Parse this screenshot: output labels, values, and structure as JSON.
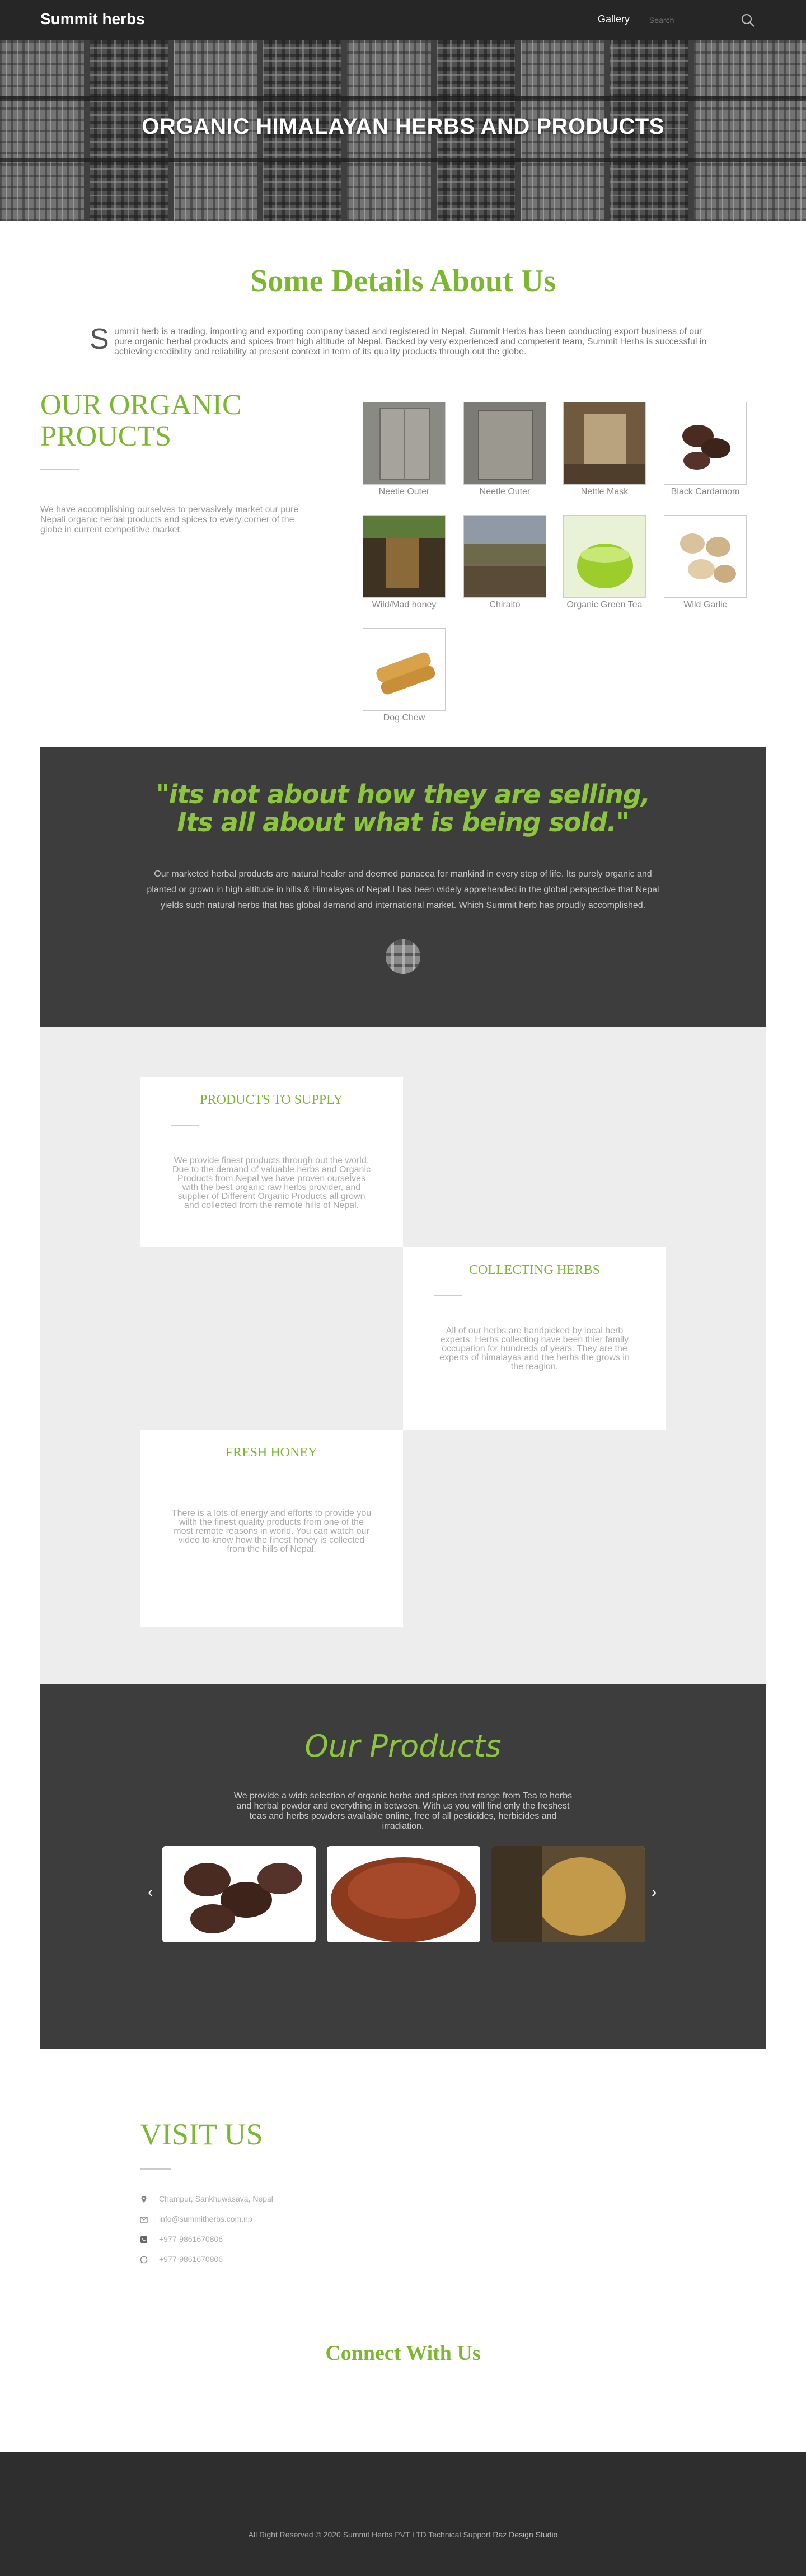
{
  "header": {
    "brand": "Summit herbs",
    "nav_gallery": "Gallery",
    "search_placeholder": "Search"
  },
  "hero": {
    "title": "ORGANIC HIMALAYAN HERBS AND PRODUCTS"
  },
  "about": {
    "title": "Some Details About Us",
    "drop_cap": "S",
    "text": "ummit herb is a trading, importing and exporting company based and registered in Nepal. Summit Herbs has been conducting export business of our pure organic herbal products and spices from high altitude of Nepal. Backed by very experienced and competent team, Summit Herbs is successful in achieving credibility and reliability at present context in term of its quality products through out the globe."
  },
  "organic": {
    "title": "OUR ORGANIC PROUCTS",
    "text": "We have accomplishing ourselves to pervasively market our pure Nepali organic herbal products and spices to every corner of the globe in current competitive market.",
    "products": [
      {
        "label": "Neetle Outer"
      },
      {
        "label": "Neetle Outer"
      },
      {
        "label": "Nettle Mask"
      },
      {
        "label": "Black Cardamom"
      },
      {
        "label": "Wild/Mad honey"
      },
      {
        "label": "Chiraito"
      },
      {
        "label": "Organic Green Tea"
      },
      {
        "label": "Wild Garlic"
      },
      {
        "label": "Dog Chew"
      }
    ]
  },
  "quote": {
    "text": "\"its not about how they are selling, Its all about what is being sold.\"",
    "body": "Our marketed herbal products are natural healer and deemed panacea for mankind in every step of life. Its purely organic and planted or grown in high altitude in hills & Himalayas of Nepal.I has been widely apprehended in the global perspective that Nepal yields such natural herbs that has global demand and international market. Which Summit herb has proudly accomplished."
  },
  "features": [
    {
      "title": "PRODUCTS TO SUPPLY",
      "text": "We provide finest products through out the world. Due to the demand of  valuable herbs and Organic Products from Nepal we have proven ourselves with the best organic raw herbs provider, and supplier of Different Organic Products all grown and collected from the remote hills of Nepal."
    },
    {
      "title": "COLLECTING HERBS",
      "text": "All of our herbs are handpicked by local herb experts. Herbs collecting have been thier family occupation for hundreds of years. They are the experts of himalayas and the herbs the grows in the reagion."
    },
    {
      "title": "FRESH HONEY",
      "text": "There is a lots of energy and efforts to provide you wilth the finest quality products from one of the most remote reasons in world. You can watch our video to know how the finest honey is collected from the hills of Nepal."
    }
  ],
  "our_products": {
    "title": "Our Products",
    "text": "We provide a wide selection of organic herbs and spices that range from Tea to herbs and herbal powder and everything in between. With us  you will find only the freshest teas and herbs powders available online, free of all pesticides, herbicides and irradiation.",
    "prev": "‹",
    "next": "›"
  },
  "visit": {
    "title": "VISIT US",
    "items": [
      {
        "icon": "map-pin-icon",
        "text": "Champur, Sankhuwasava, Nepal"
      },
      {
        "icon": "mail-icon",
        "text": "info@summitherbs.com.np"
      },
      {
        "icon": "phone-icon",
        "text": "+977-9861670806"
      },
      {
        "icon": "whatsapp-icon",
        "text": "+977-9861670806"
      }
    ]
  },
  "connect": {
    "title": "Connect With Us"
  },
  "footer": {
    "text": "All Right Reserved © 2020 Summit Herbs PVT LTD Technical Support ",
    "link": "Raz Design Studio"
  },
  "colors": {
    "accent_green": "#7cb82f",
    "dark_panel": "#3d3d3d",
    "footer": "#2e2e2e"
  }
}
